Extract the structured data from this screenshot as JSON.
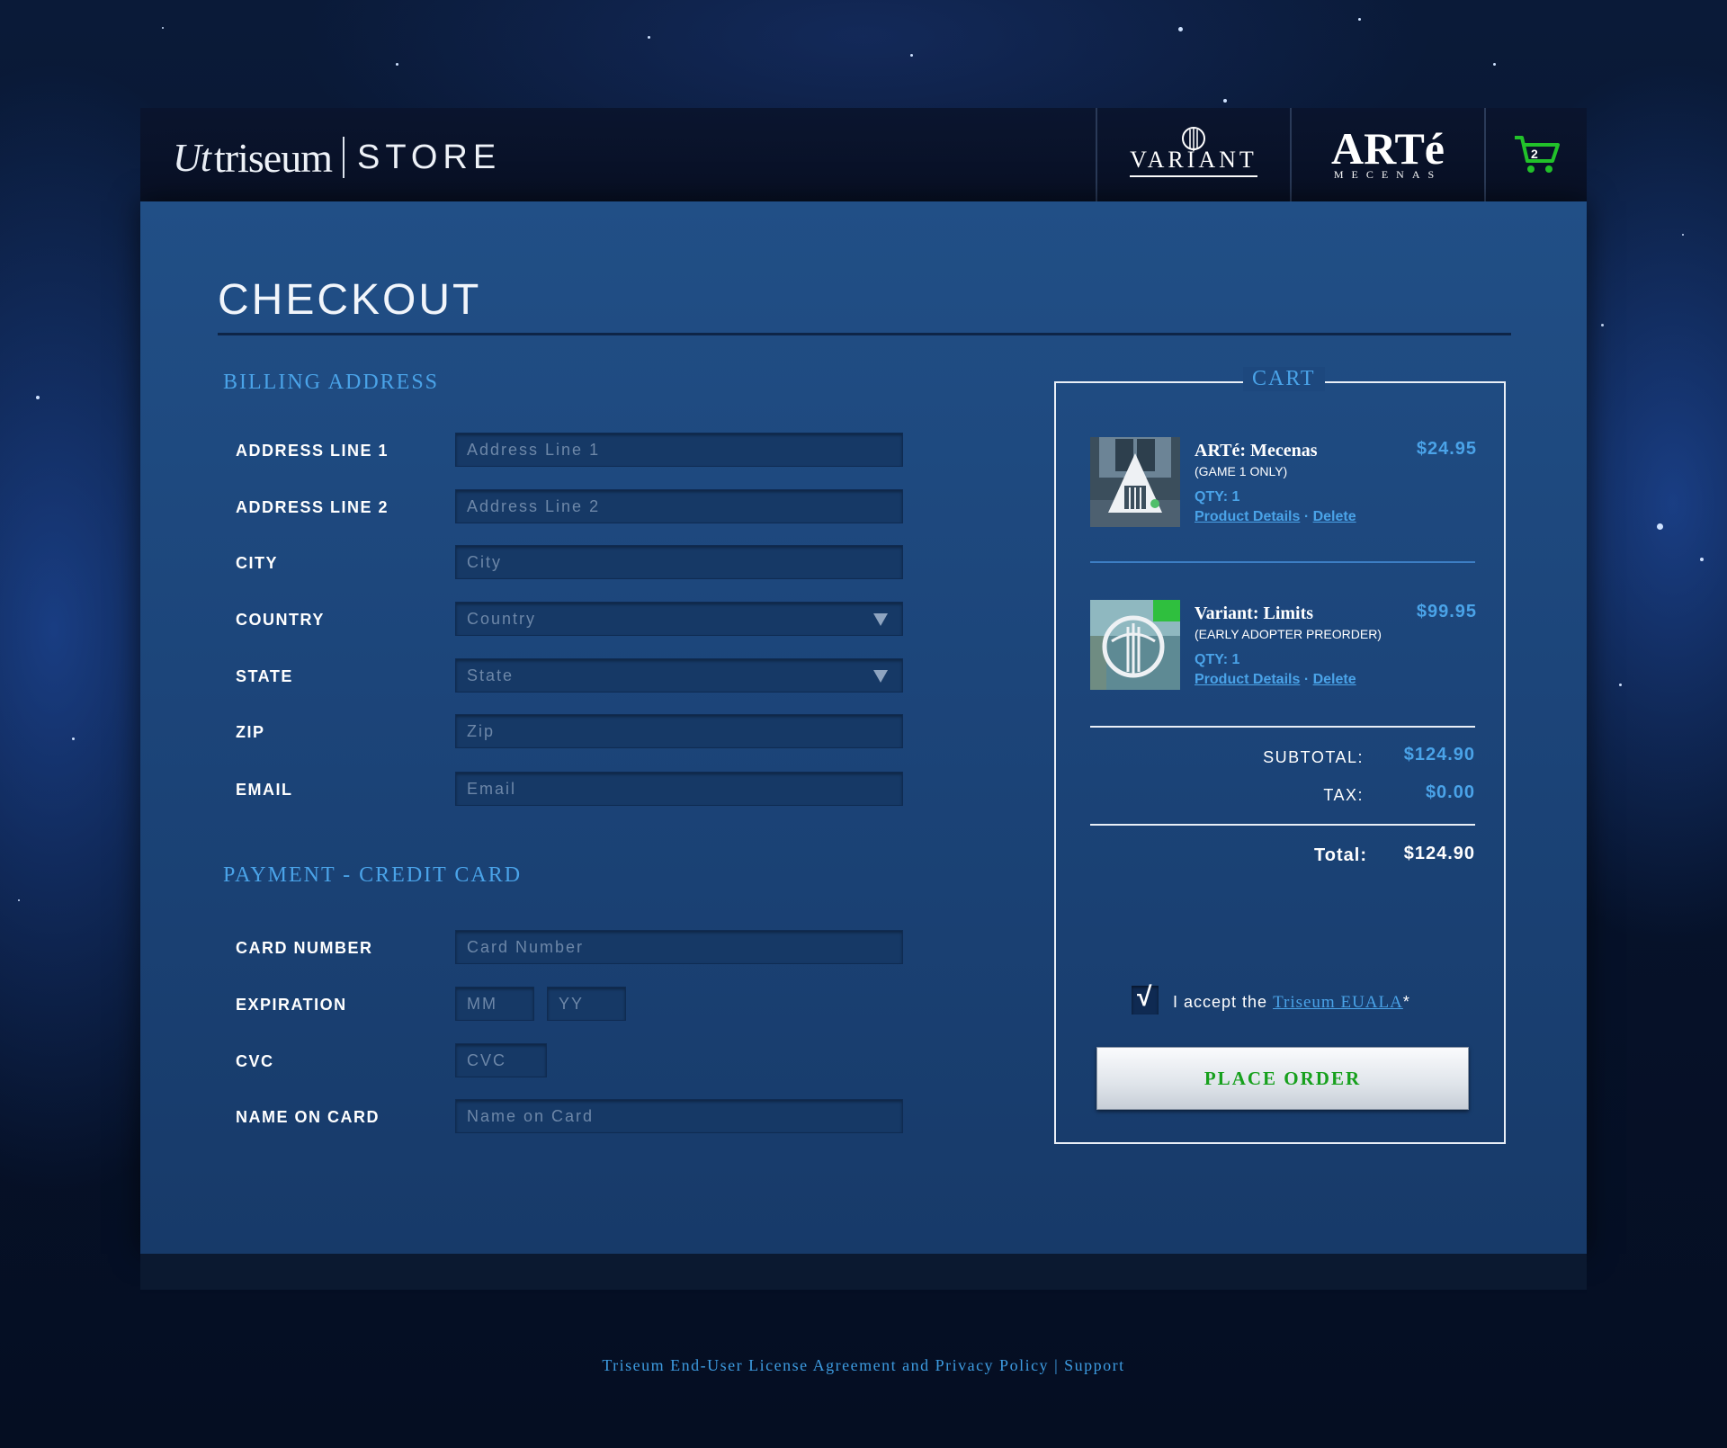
{
  "header": {
    "brand_mark": "Ut",
    "brand_name": "triseum",
    "store_label": "STORE",
    "nav": {
      "variant_label": "VARIANT",
      "arte_label": "ARTé",
      "arte_sub": "MECENAS",
      "cart_count": "2"
    }
  },
  "page": {
    "title": "CHECKOUT"
  },
  "billing": {
    "heading": "BILLING ADDRESS",
    "fields": [
      {
        "label": "ADDRESS LINE 1",
        "placeholder": "Address Line 1"
      },
      {
        "label": "ADDRESS LINE 2",
        "placeholder": "Address Line 2"
      },
      {
        "label": "CITY",
        "placeholder": "City"
      },
      {
        "label": "COUNTRY",
        "placeholder": "Country"
      },
      {
        "label": "STATE",
        "placeholder": "State"
      },
      {
        "label": "ZIP",
        "placeholder": "Zip"
      },
      {
        "label": "EMAIL",
        "placeholder": "Email"
      }
    ]
  },
  "payment": {
    "heading": "PAYMENT - CREDIT CARD",
    "card_number": {
      "label": "CARD NUMBER",
      "placeholder": "Card Number"
    },
    "expiration": {
      "label": "EXPIRATION",
      "mm_placeholder": "MM",
      "yy_placeholder": "YY"
    },
    "cvc": {
      "label": "CVC",
      "placeholder": "CVC"
    },
    "name_on_card": {
      "label": "NAME ON CARD",
      "placeholder": "Name on Card"
    }
  },
  "cart": {
    "title": "CART",
    "items": [
      {
        "name": "ARTé: Mecenas",
        "subtitle": "(GAME 1 ONLY)",
        "qty": "QTY: 1",
        "price": "$24.95",
        "details_link": "Product Details",
        "delete_link": "Delete"
      },
      {
        "name": "Variant: Limits",
        "subtitle": "(EARLY ADOPTER PREORDER)",
        "qty": "QTY: 1",
        "price": "$99.95",
        "details_link": "Product Details",
        "delete_link": "Delete"
      }
    ],
    "link_separator": "·",
    "subtotal_label": "SUBTOTAL:",
    "subtotal": "$124.90",
    "tax_label": "TAX:",
    "tax": "$0.00",
    "total_label": "Total:",
    "total": "$124.90",
    "accept_prefix": "I accept the ",
    "accept_link": "Triseum EUALA",
    "accept_suffix": "*",
    "checkmark": "√",
    "place_order": "PLACE ORDER"
  },
  "footer": {
    "eula_link": "Triseum End-User License Agreement and Privacy Policy",
    "separator": " | ",
    "support_link": "Support"
  },
  "colors": {
    "accent_blue": "#4aa3e8",
    "order_green": "#17a01d",
    "cart_green": "#22c22a"
  }
}
